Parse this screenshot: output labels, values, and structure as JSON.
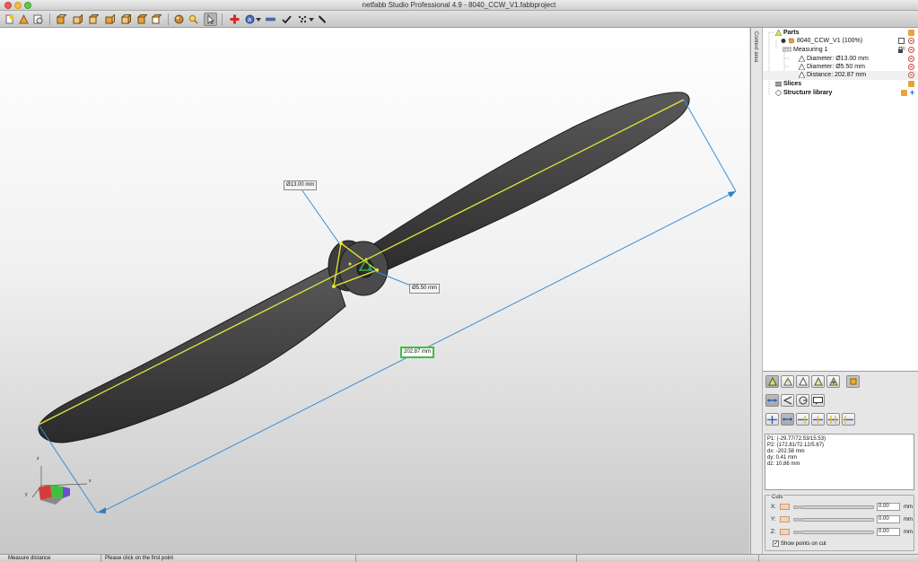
{
  "window": {
    "title": "netfabb Studio Professional 4.9 - 8040_CCW_V1.fabbproject"
  },
  "toolbar": {
    "icons": [
      "new-part-icon",
      "open-icon",
      "settings-icon",
      "view-front-icon",
      "view-back-icon",
      "view-left-icon",
      "view-right-icon",
      "view-top-icon",
      "view-bottom-icon",
      "sphere-icon",
      "zoom-icon",
      "select-icon",
      "repair-icon",
      "analysis-icon",
      "minus-icon",
      "check-icon",
      "tools-icon",
      "pen-icon"
    ]
  },
  "viewport": {
    "labels": {
      "diameter_outer": "Ø13.00 mm",
      "diameter_inner": "Ø5.50 mm",
      "distance": "202.87 mm"
    },
    "axes": {
      "x": "x",
      "y": "y",
      "z": "z"
    },
    "colors": {
      "measure_line": "#3a8fd6",
      "axis_line": "#e6e63a",
      "highlight": "#3fbf3f"
    }
  },
  "side_tab": {
    "label": "Context area"
  },
  "tree": {
    "parts_label": "Parts",
    "part_name": "8040_CCW_V1 (100%)",
    "measuring_label": "Measuring 1",
    "measurements": [
      "Diameter: Ø13.00 mm",
      "Diameter: Ø5.50 mm",
      "Distance: 202.87 mm"
    ],
    "slices_label": "Slices",
    "structure_label": "Structure library"
  },
  "info": {
    "lines": [
      "P1: (-29.77/72.53/15.53)",
      "P2: (172.81/72.12/5.67)",
      "dx: -202.58 mm",
      "dy: 0.41 mm",
      "dz: 10.86 mm"
    ]
  },
  "cuts": {
    "title": "Cuts",
    "x_label": "X:",
    "y_label": "Y:",
    "z_label": "Z:",
    "x_value": "0.00",
    "y_value": "0.00",
    "z_value": "0.00",
    "unit": "mm",
    "show_points_label": "Show points on cut"
  },
  "status": {
    "mode": "Measure distance",
    "hint": "Please click on the first point"
  }
}
